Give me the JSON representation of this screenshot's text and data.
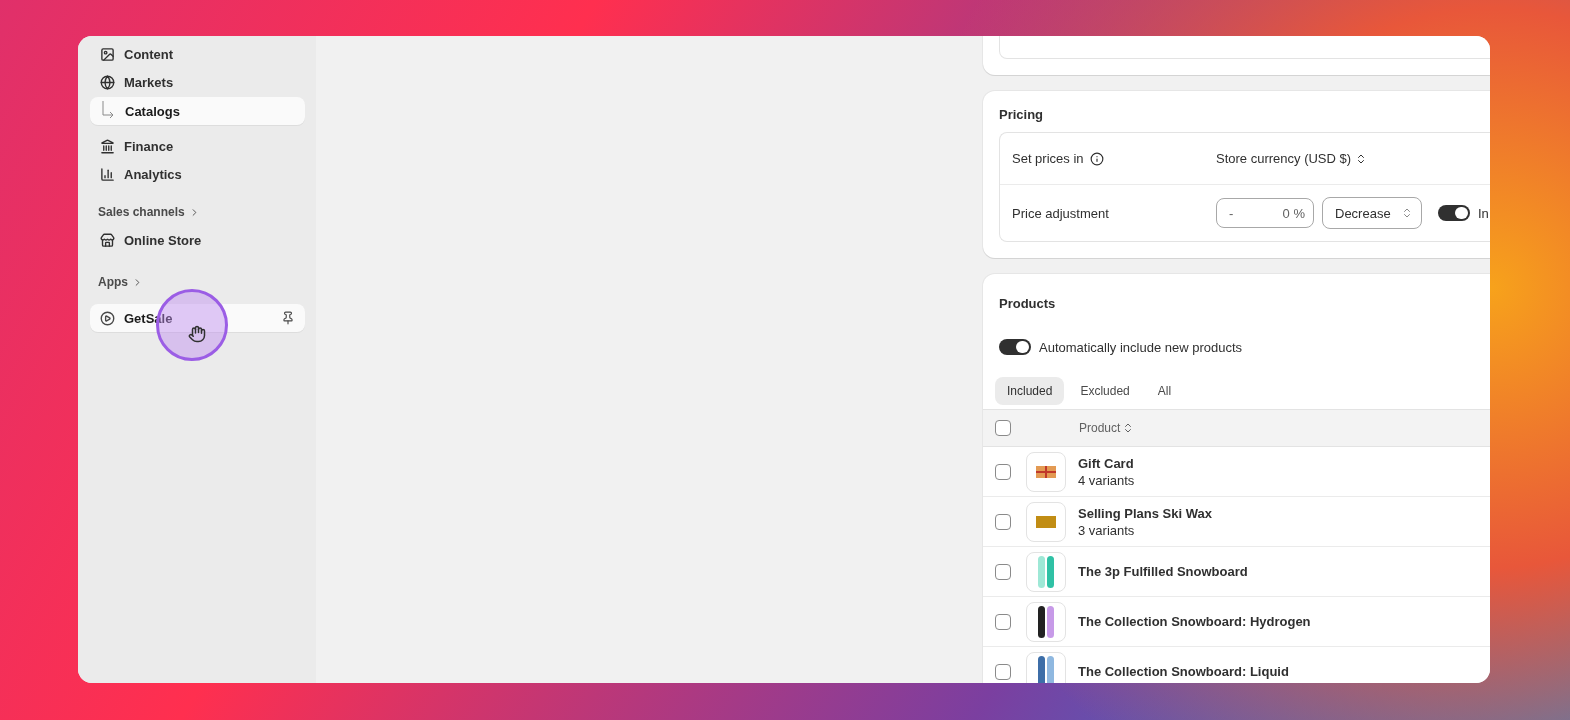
{
  "sidebar": {
    "items": [
      {
        "kind": "nav",
        "label": "Content",
        "selected": false
      },
      {
        "kind": "nav",
        "label": "Markets",
        "selected": false
      },
      {
        "kind": "sub",
        "label": "Catalogs",
        "selected": true
      },
      {
        "kind": "nav",
        "label": "Finance",
        "selected": false
      },
      {
        "kind": "nav",
        "label": "Analytics",
        "selected": false
      },
      {
        "kind": "section",
        "label": "Sales channels"
      },
      {
        "kind": "nav",
        "label": "Online Store",
        "selected": false
      },
      {
        "kind": "section",
        "label": "Apps"
      },
      {
        "kind": "app",
        "label": "GetSale",
        "selected": true
      }
    ]
  },
  "pricing": {
    "title": "Pricing",
    "set_prices": {
      "label": "Set prices in",
      "value": "Store currency (USD $)"
    },
    "adjustment": {
      "label": "Price adjustment",
      "sign": "-",
      "amount": "0",
      "unit": "%",
      "direction": "Decrease",
      "toggle_on": true,
      "toggle_label": "In"
    }
  },
  "products": {
    "title": "Products",
    "auto_include": {
      "label": "Automatically include new products",
      "on": true
    },
    "tabs": [
      {
        "label": "Included",
        "selected": true
      },
      {
        "label": "Excluded",
        "selected": false
      },
      {
        "label": "All",
        "selected": false
      }
    ],
    "header": {
      "label": "Product",
      "checked": false
    },
    "rows": [
      {
        "kind": "gift",
        "name": "Gift Card",
        "variants": "4 variants",
        "checked": false
      },
      {
        "kind": "wax",
        "name": "Selling Plans Ski Wax",
        "variants": "3 variants",
        "checked": false
      },
      {
        "kind": "board-teal",
        "name": "The 3p Fulfilled Snowboard",
        "checked": false
      },
      {
        "kind": "board-dark",
        "name": "The Collection Snowboard: Hydrogen",
        "checked": false
      },
      {
        "kind": "board-blue",
        "name": "The Collection Snowboard: Liquid",
        "checked": false
      }
    ]
  }
}
